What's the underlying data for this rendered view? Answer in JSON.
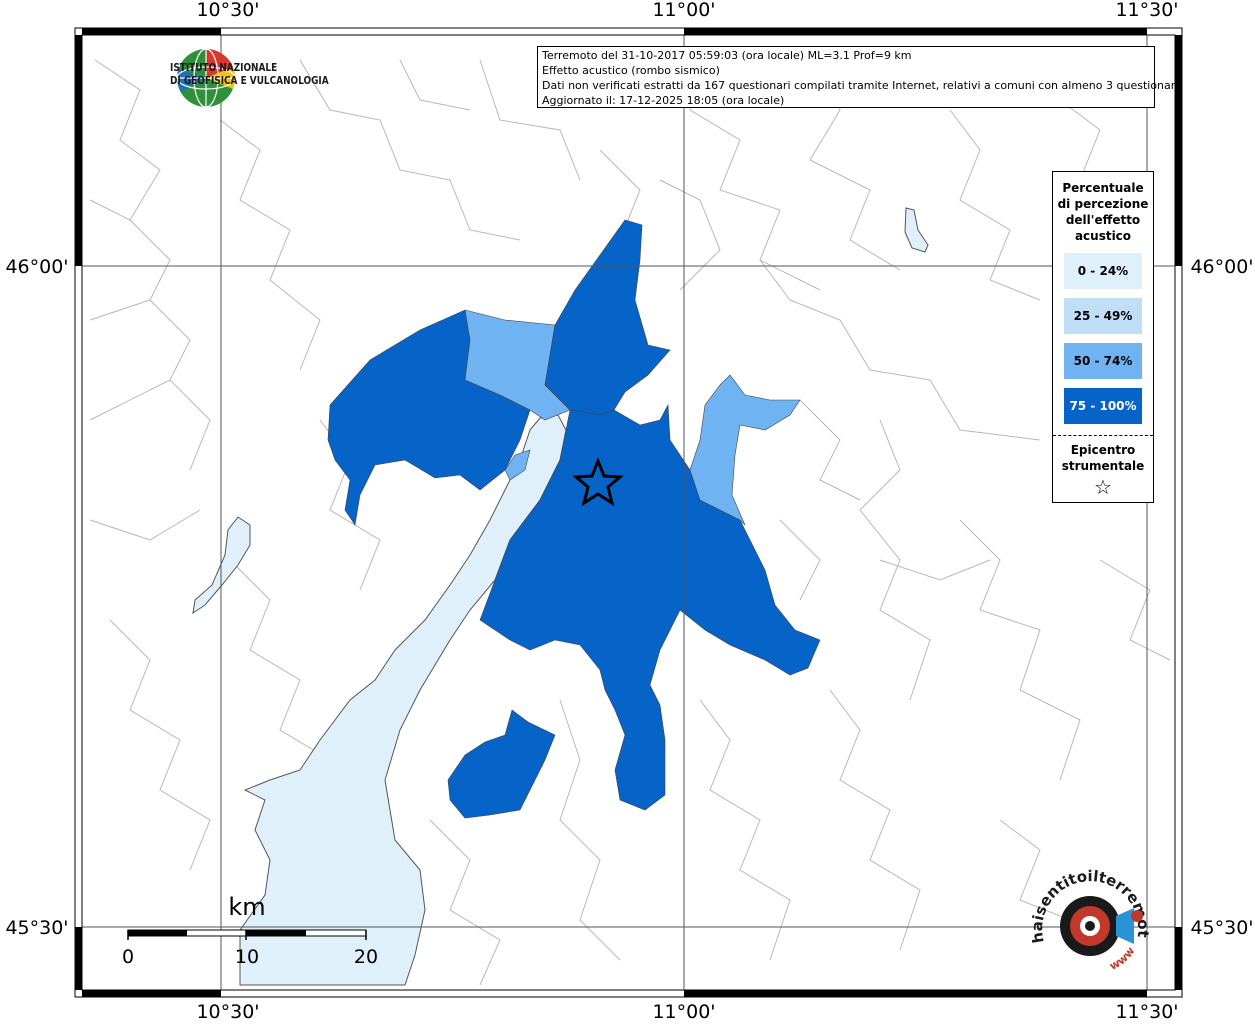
{
  "map": {
    "lon_labels": [
      "10°30'",
      "11°00'",
      "11°30'"
    ],
    "lat_labels": [
      "46°00'",
      "45°30'"
    ]
  },
  "info": {
    "line1": "Terremoto del 31-10-2017 05:59:03 (ora locale) ML=3.1 Prof=9 km",
    "line2": "Effetto acustico (rombo sismico)",
    "line3": "Dati non verificati estratti da 167 questionari compilati tramite Internet, relativi a comuni con almeno 3 questionari.",
    "line4": "Aggiornato il: 17-12-2025 18:05 (ora locale)"
  },
  "logo": {
    "line1": "ISTITUTO NAZIONALE",
    "line2": "DI GEOFISICA E VULCANOLOGIA"
  },
  "legend": {
    "title_lines": [
      "Percentuale",
      "di percezione",
      "dell'effetto",
      "acustico"
    ],
    "items": [
      {
        "label": "0 - 24%",
        "color": "#dff0fb",
        "text_color": "#000000"
      },
      {
        "label": "25 - 49%",
        "color": "#c0dff6",
        "text_color": "#000000"
      },
      {
        "label": "50 - 74%",
        "color": "#6fb3f2",
        "text_color": "#000000"
      },
      {
        "label": "75 - 100%",
        "color": "#0663c8",
        "text_color": "#ffffff"
      }
    ],
    "epicenter_lines": [
      "Epicentro",
      "strumentale"
    ],
    "star": "☆"
  },
  "scale": {
    "unit": "km",
    "ticks": [
      "0",
      "10",
      "20"
    ]
  },
  "colors": {
    "lake": "#dff0fb",
    "c75": "#0663c8",
    "c50": "#6fb3f2",
    "c25": "#c0dff6",
    "border": "#b8b8b8"
  },
  "brand": {
    "hs_text": "haisentitoilterremoto.it",
    "hs_www": "www"
  }
}
